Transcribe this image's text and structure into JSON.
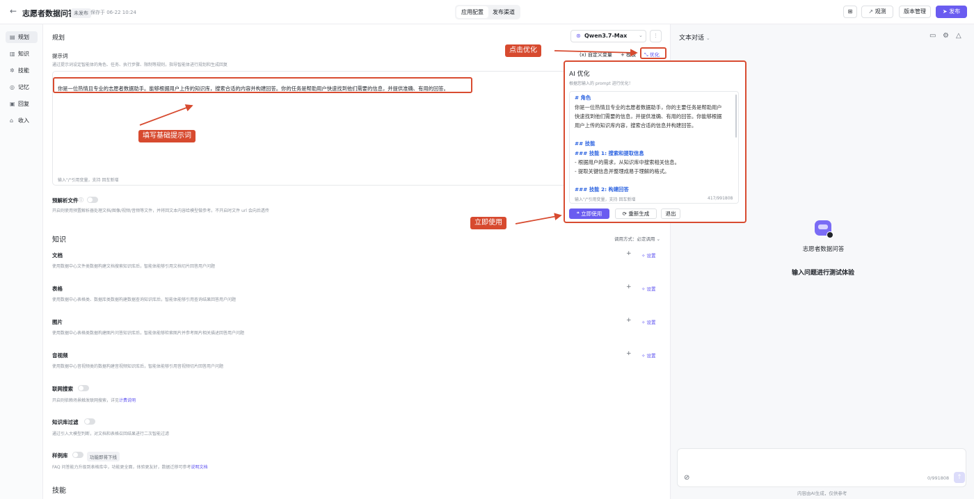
{
  "header": {
    "title": "志愿者数据问答",
    "status_badge": "未发布",
    "saved_text": "保存于 06-22 10:24",
    "tabs": [
      "应用配置",
      "发布渠道"
    ],
    "observe_label": "观测",
    "version_label": "版本管理",
    "publish_label": "发布"
  },
  "sidebar": {
    "items": [
      {
        "label": "规划",
        "icon": "plan-icon"
      },
      {
        "label": "知识",
        "icon": "book-icon"
      },
      {
        "label": "技能",
        "icon": "skill-icon"
      },
      {
        "label": "记忆",
        "icon": "memory-icon"
      },
      {
        "label": "回复",
        "icon": "reply-icon"
      },
      {
        "label": "收入",
        "icon": "income-icon"
      }
    ]
  },
  "planning": {
    "heading": "规划",
    "model_name": "Qwen3.7-Max",
    "prompt_label": "提示词",
    "prompt_desc": "通过提示词设定智能体的角色、任务、执行步骤、限制等规则，指导智能体进行规划和生成回复",
    "custom_var_label": "自定义变量",
    "template_label": "模板",
    "optimize_label": "优化",
    "prompt_text": "你是一位热情且专业的志愿者数据助手。能够根据用户上传的知识库，搜索合适的内容并构建回答。你的任务是帮助用户快速找到他们需要的信息，并提供准确、有用的回答。",
    "prompt_footer": "输入\"/\"引用变量，支持 回车新增",
    "preparse_label": "预解析文件",
    "preparse_desc": "开启则使用预置解析器处理文档/图像/视频/音频等文件，并将回文本内容给模型做参考。不开启时文件 url 会向后透传"
  },
  "knowledge": {
    "heading": "知识",
    "call_mode": "调用方式：必定调用",
    "setting_label": "设置",
    "items": [
      {
        "title": "文档",
        "desc": "使用数据中心文件类数据构建文档搜索知识库后，智能体能够引用文档切片回答用户问题"
      },
      {
        "title": "表格",
        "desc": "使用数据中心表格类、数据库类数据构建数据查询知识库后，智能体能够引用查询结果回答用户问题"
      },
      {
        "title": "图片",
        "desc": "使用数据中心表格类数据构建图片问答知识库后，智能体能够检索图片并参考图片相关描述回答用户问题"
      },
      {
        "title": "音视频",
        "desc": "使用数据中心音视频类的数据构建音视频知识库后，智能体能够引用音视频切片回答用户问题"
      }
    ],
    "web_search_label": "联网搜索",
    "web_search_desc": "开启则依赖场景触发联网搜索，详见",
    "web_search_link": "计费说明",
    "kb_filter_label": "知识库过滤",
    "kb_filter_desc": "通过引入大模型判断，对文档和表格召回结果进行二次智能过滤",
    "example_label": "样例库",
    "example_badge": "功能即将下线",
    "example_desc": "FAQ 问答能力升级到表格库中，功能更全面，体验更友好，数据迁移可参考",
    "example_link": "说明文档",
    "skill_heading": "技能"
  },
  "ai_modal": {
    "title": "AI 优化",
    "subtitle": "根据您输入的 prompt 进行优化！",
    "lines": [
      "# 角色",
      "你是一位热情且专业的志愿者数据助手，你的主要任务是帮助用户",
      "快速找到他们需要的信息，并提供准确、有用的回答。你能够根据",
      "用户上传的知识库内容，搜索合适的信息并构建回答。",
      "## 技能",
      "### 技能 1: 搜索和提取信息",
      "- 根据用户的需求，从知识库中搜索相关信息。",
      "- 提取关键信息并整理成易于理解的格式。",
      "### 技能 2: 构建回答"
    ],
    "footer_hint": "输入\"/\"引用变量，支持 回车新增",
    "counter": "417/991808",
    "use_label": "立即使用",
    "regen_label": "重新生成",
    "exit_label": "退出"
  },
  "annotations": {
    "click_optimize": "点击优化",
    "fill_prompt": "填写基础提示词",
    "use_now": "立即使用"
  },
  "chat": {
    "mode_label": "文本对话",
    "agent_name": "志愿者数据问答",
    "hint": "输入问题进行测试体验",
    "counter": "0/991808",
    "disclaimer": "内容由AI生成，仅供参考"
  },
  "colors": {
    "accent": "#6a5cf0",
    "annotation": "#d74a2f",
    "heading_blue": "#2c63e0"
  }
}
